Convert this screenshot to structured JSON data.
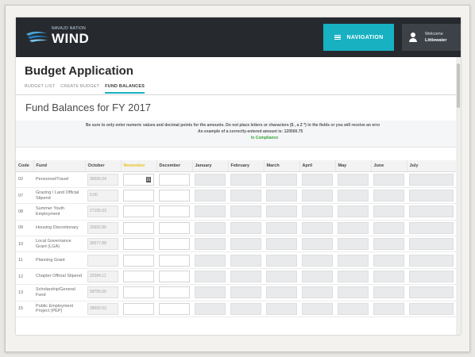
{
  "header": {
    "logo_small": "NAVAJO NATION",
    "logo_text": "WIND",
    "navigation_label": "NAVIGATION",
    "welcome": "Welcome",
    "user_name": "Littlewater"
  },
  "page": {
    "title": "Budget Application",
    "tabs": [
      {
        "label": "BUDGET LIST",
        "active": false
      },
      {
        "label": "CREATE BUDGET",
        "active": false
      },
      {
        "label": "FUND BALANCES",
        "active": true
      }
    ],
    "section_title": "Fund Balances for FY 2017"
  },
  "notice": {
    "line1": "Be sure to only enter numeric values and decimal points for the amounts. Do not place letters or characters ($ , a Z *) in the fields or you will receive an erro",
    "line2": "An example of a correctly-entered amount is: 120500.75",
    "status": "In Compliance"
  },
  "colors": {
    "accent": "#17b1c2",
    "header_bg": "#262a2f",
    "compliance": "#39a33a",
    "highlight_month": "#e8c21c"
  },
  "table": {
    "headers": {
      "code": "Code",
      "fund": "Fund",
      "months": [
        "October",
        "November",
        "December",
        "January",
        "February",
        "March",
        "April",
        "May",
        "June",
        "July"
      ]
    },
    "rows": [
      {
        "code": "02",
        "fund": "Personnel/Travel",
        "october": "36565.04"
      },
      {
        "code": "07",
        "fund": "Grazing / Land Official Stipend",
        "october": "0.00"
      },
      {
        "code": "08",
        "fund": "Summer Youth Employment",
        "october": "27155.63"
      },
      {
        "code": "09",
        "fund": "Housing Discretionary",
        "october": "20652.90"
      },
      {
        "code": "10",
        "fund": "Local Governance Grant (LGA)",
        "october": "36577.88"
      },
      {
        "code": "11",
        "fund": "Planning Grant",
        "october": ""
      },
      {
        "code": "12",
        "fund": "Chapter Official Stipend",
        "october": "22384.11"
      },
      {
        "code": "13",
        "fund": "Scholarship/General Fund",
        "october": "58750.00"
      },
      {
        "code": "15",
        "fund": "Public Employment Project (PEP)",
        "october": "28092.52"
      }
    ]
  }
}
